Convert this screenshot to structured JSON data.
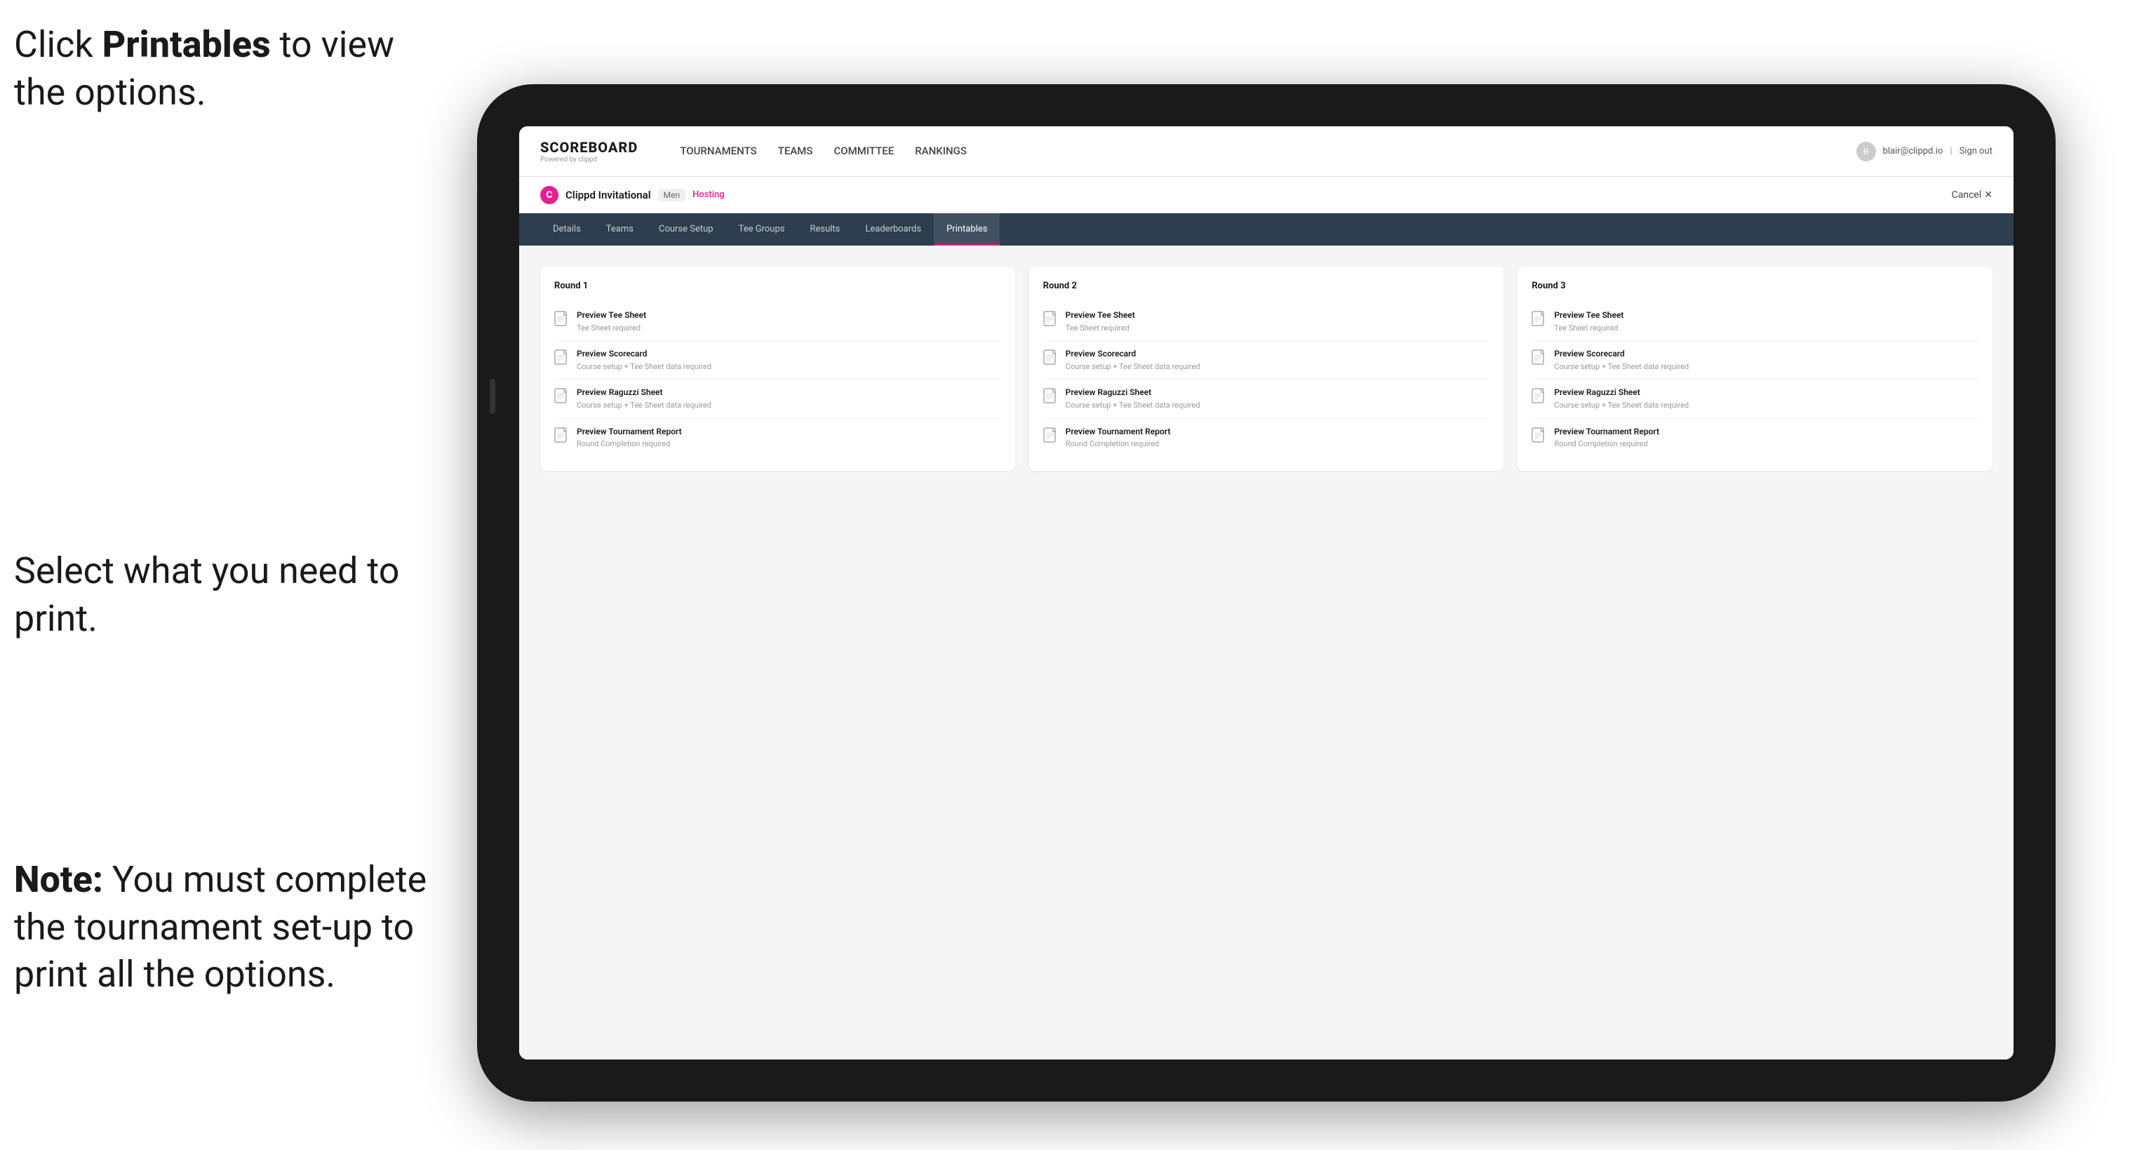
{
  "annotations": {
    "top": {
      "prefix": "Click ",
      "bold": "Printables",
      "suffix": " to view the options."
    },
    "middle": {
      "text": "Select what you need to print."
    },
    "bottom": {
      "bold_prefix": "Note:",
      "suffix": " You must complete the tournament set-up to print all the options."
    }
  },
  "nav": {
    "logo": "SCOREBOARD",
    "logo_sub": "Powered by clippd",
    "items": [
      "TOURNAMENTS",
      "TEAMS",
      "COMMITTEE",
      "RANKINGS"
    ],
    "user_email": "blair@clippd.io",
    "sign_out": "Sign out"
  },
  "sub_header": {
    "logo_letter": "C",
    "tournament_name": "Clippd Invitational",
    "badge": "Men",
    "hosting": "Hosting",
    "cancel": "Cancel"
  },
  "tabs": [
    {
      "label": "Details",
      "active": false
    },
    {
      "label": "Teams",
      "active": false
    },
    {
      "label": "Course Setup",
      "active": false
    },
    {
      "label": "Tee Groups",
      "active": false
    },
    {
      "label": "Results",
      "active": false
    },
    {
      "label": "Leaderboards",
      "active": false
    },
    {
      "label": "Printables",
      "active": true
    }
  ],
  "rounds": [
    {
      "title": "Round 1",
      "items": [
        {
          "title": "Preview Tee Sheet",
          "subtitle": "Tee Sheet required"
        },
        {
          "title": "Preview Scorecard",
          "subtitle": "Course setup + Tee Sheet data required"
        },
        {
          "title": "Preview Raguzzi Sheet",
          "subtitle": "Course setup + Tee Sheet data required"
        },
        {
          "title": "Preview Tournament Report",
          "subtitle": "Round Completion required"
        }
      ]
    },
    {
      "title": "Round 2",
      "items": [
        {
          "title": "Preview Tee Sheet",
          "subtitle": "Tee Sheet required"
        },
        {
          "title": "Preview Scorecard",
          "subtitle": "Course setup + Tee Sheet data required"
        },
        {
          "title": "Preview Raguzzi Sheet",
          "subtitle": "Course setup + Tee Sheet data required"
        },
        {
          "title": "Preview Tournament Report",
          "subtitle": "Round Completion required"
        }
      ]
    },
    {
      "title": "Round 3",
      "items": [
        {
          "title": "Preview Tee Sheet",
          "subtitle": "Tee Sheet required"
        },
        {
          "title": "Preview Scorecard",
          "subtitle": "Course setup + Tee Sheet data required"
        },
        {
          "title": "Preview Raguzzi Sheet",
          "subtitle": "Course setup + Tee Sheet data required"
        },
        {
          "title": "Preview Tournament Report",
          "subtitle": "Round Completion required"
        }
      ]
    }
  ]
}
